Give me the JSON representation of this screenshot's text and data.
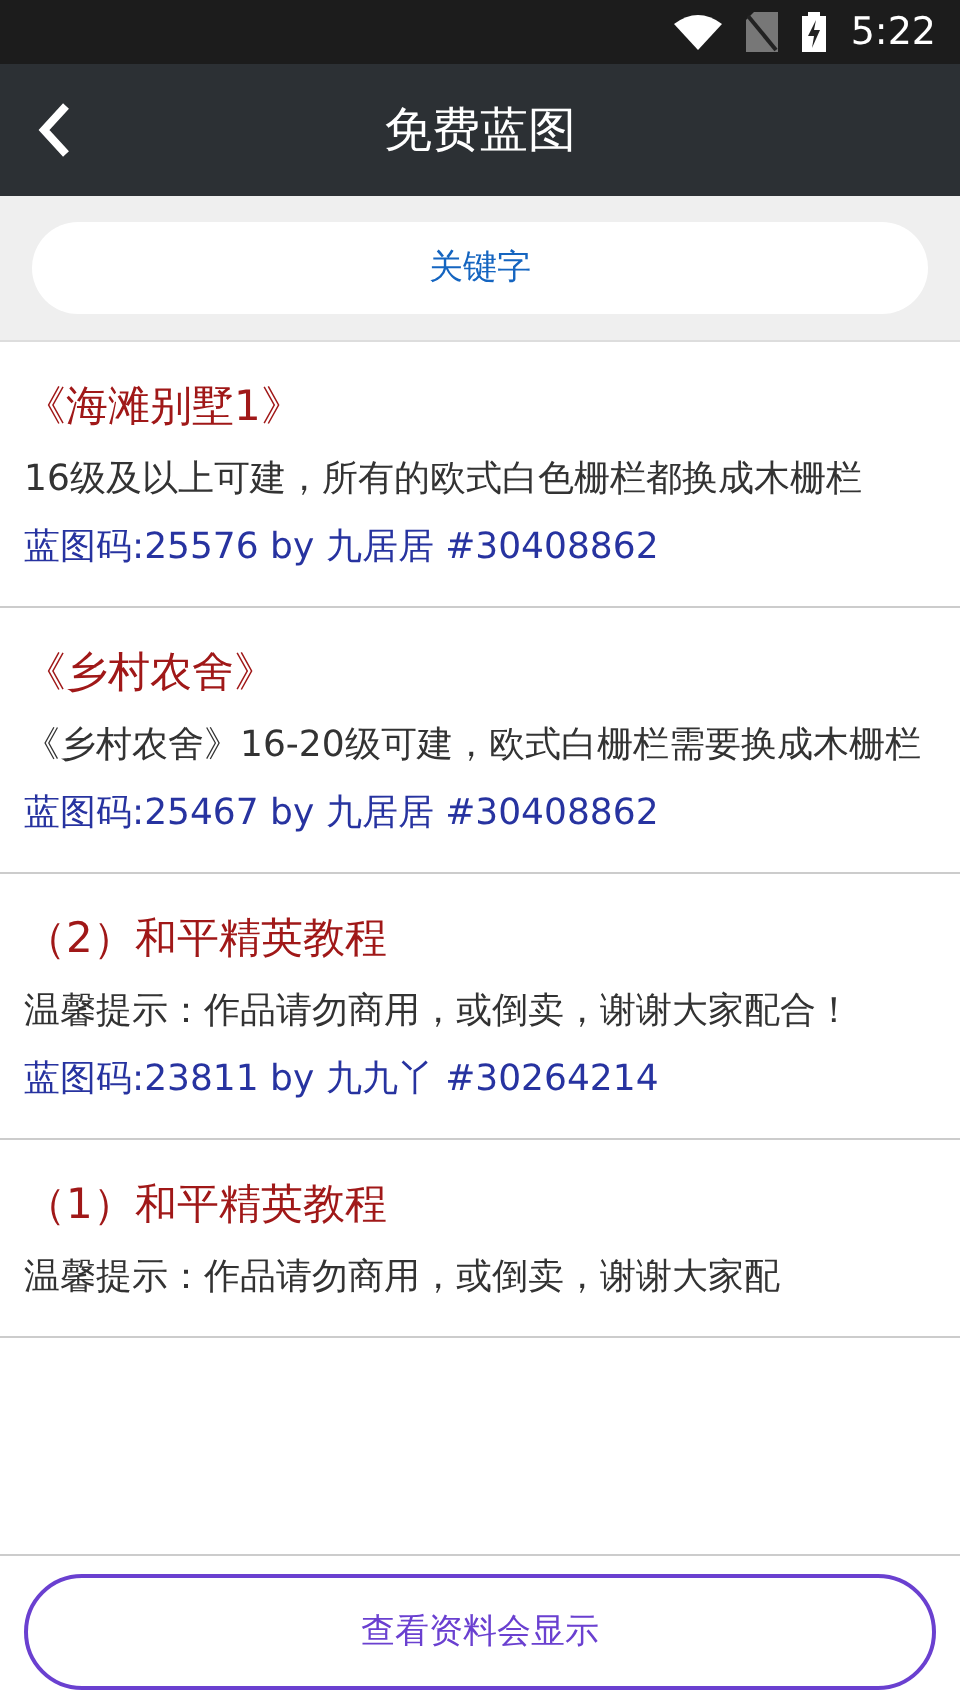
{
  "status_bar": {
    "time": "5:22"
  },
  "header": {
    "title": "免费蓝图"
  },
  "search": {
    "placeholder": "关键字"
  },
  "items": [
    {
      "title": "《海滩别墅1》",
      "description": "16级及以上可建，所有的欧式白色栅栏都换成木栅栏",
      "code": "蓝图码:25576 by 九居居 #30408862"
    },
    {
      "title": "《乡村农舍》",
      "description": "《乡村农舍》16-20级可建，欧式白栅栏需要换成木栅栏",
      "code": "蓝图码:25467 by 九居居 #30408862"
    },
    {
      "title": "（2）和平精英教程",
      "description": "温馨提示：作品请勿商用，或倒卖，谢谢大家配合！",
      "code": "蓝图码:23811 by 九九丫 #30264214"
    },
    {
      "title": "（1）和平精英教程",
      "description": "温馨提示：作品请勿商用，或倒卖，谢谢大家配"
    }
  ],
  "bottom_button": {
    "label": "查看资料会显示"
  }
}
